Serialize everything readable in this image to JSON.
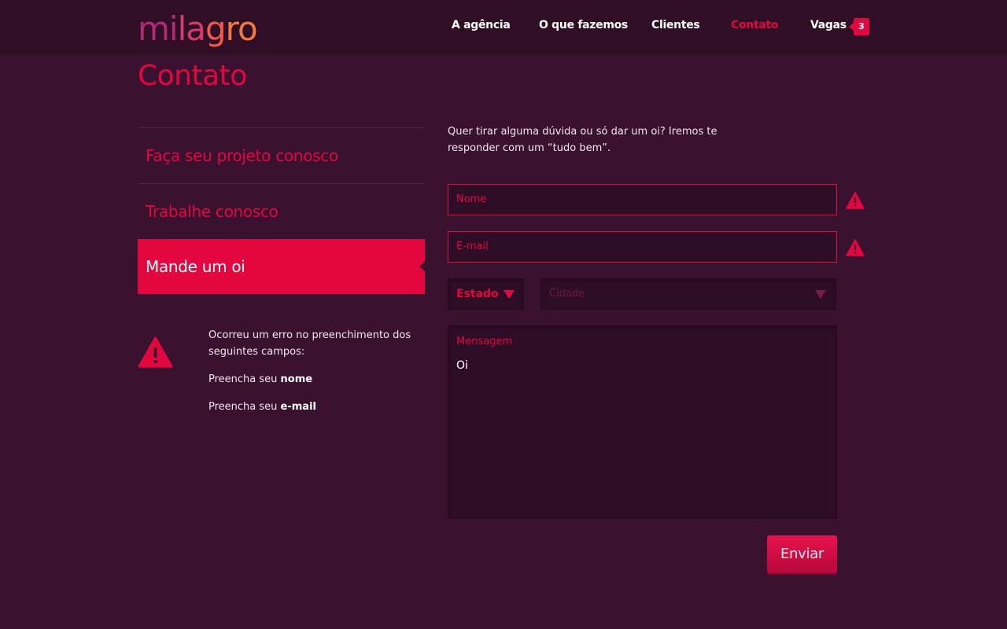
{
  "brand": {
    "logo_parts": [
      "mi",
      "la",
      "g",
      "ro"
    ],
    "accent": "#e3063f",
    "background": "#3a1230"
  },
  "nav": {
    "items": [
      {
        "label": "A agência"
      },
      {
        "label": "O que fazemos"
      },
      {
        "label": "Clientes"
      },
      {
        "label": "Contato",
        "active": true
      },
      {
        "label": "Vagas"
      }
    ],
    "vagas_badge": "3"
  },
  "page": {
    "title": "Contato"
  },
  "side_menu": {
    "items": [
      {
        "label": "Faça seu projeto conosco"
      },
      {
        "label": "Trabalhe conosco"
      },
      {
        "label": "Mande um oi",
        "active": true
      }
    ]
  },
  "error": {
    "icon": "warning-icon",
    "message": "Ocorreu um erro no preenchimento dos seguintes campos:",
    "items": [
      {
        "prefix": "Preencha seu ",
        "field": "nome"
      },
      {
        "prefix": "Preencha seu ",
        "field": "e-mail"
      }
    ]
  },
  "form": {
    "intro": "Quer tirar alguma dúvida ou só dar um oi? Iremos te responder com um “tudo bem”.",
    "name_placeholder": "Nome",
    "email_placeholder": "E-mail",
    "state_select": "Estado",
    "city_select": "Cidade",
    "message_label": "Mensagem",
    "message_value": "Oi",
    "submit_label": "Enviar"
  }
}
